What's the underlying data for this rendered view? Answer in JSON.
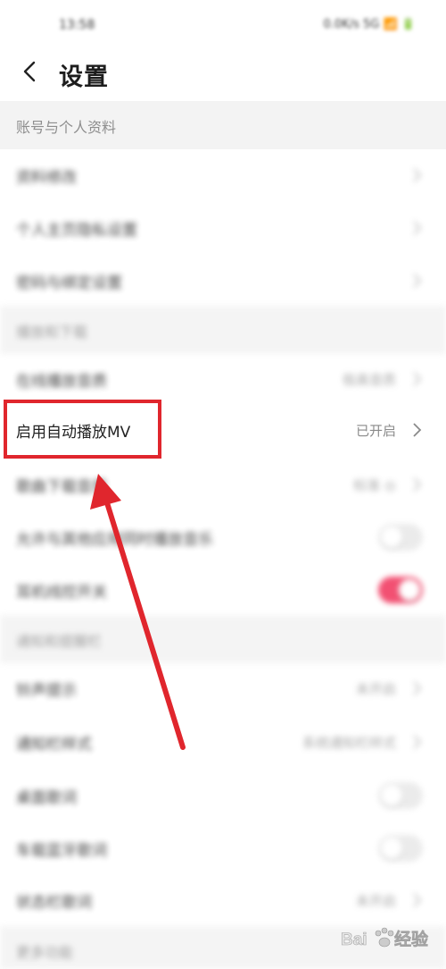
{
  "status_bar": {
    "time": "13:58",
    "indicators": "0.0K/s 5G 📶 🔋"
  },
  "nav": {
    "back_icon": "chevron-left-icon",
    "title": "设置"
  },
  "sections": {
    "account": {
      "header": "账号与个人资料",
      "rows": [
        {
          "label": "资料修改"
        },
        {
          "label": "个人主页隐私设置"
        },
        {
          "label": "密码与绑定设置"
        }
      ]
    },
    "playback": {
      "header": "播放和下载",
      "rows": [
        {
          "label": "在线播放音质",
          "value": "极高音质"
        },
        {
          "label": "启用自动播放MV",
          "value": "已开启"
        },
        {
          "label": "歌曲下载音质",
          "value": "标准 ◎"
        },
        {
          "label": "允许与其他应用同时播放音乐",
          "toggle": false
        },
        {
          "label": "耳机线控开关",
          "toggle": true
        }
      ]
    },
    "notifications": {
      "header": "通知和提醒栏",
      "rows": [
        {
          "label": "铃声提示",
          "value": "未开启"
        },
        {
          "label": "通知栏样式",
          "value": "系统通知栏样式"
        },
        {
          "label": "桌面歌词",
          "toggle": false
        },
        {
          "label": "车载蓝牙歌词",
          "toggle": false
        },
        {
          "label": "状态栏歌词",
          "value": "未开启"
        }
      ]
    },
    "more": {
      "header": "更多功能"
    }
  },
  "annotation": {
    "highlight_color": "#e0262d",
    "toggle_on_color": "#f0325a"
  },
  "watermark": {
    "text": "经验",
    "brand": "Bai du"
  }
}
